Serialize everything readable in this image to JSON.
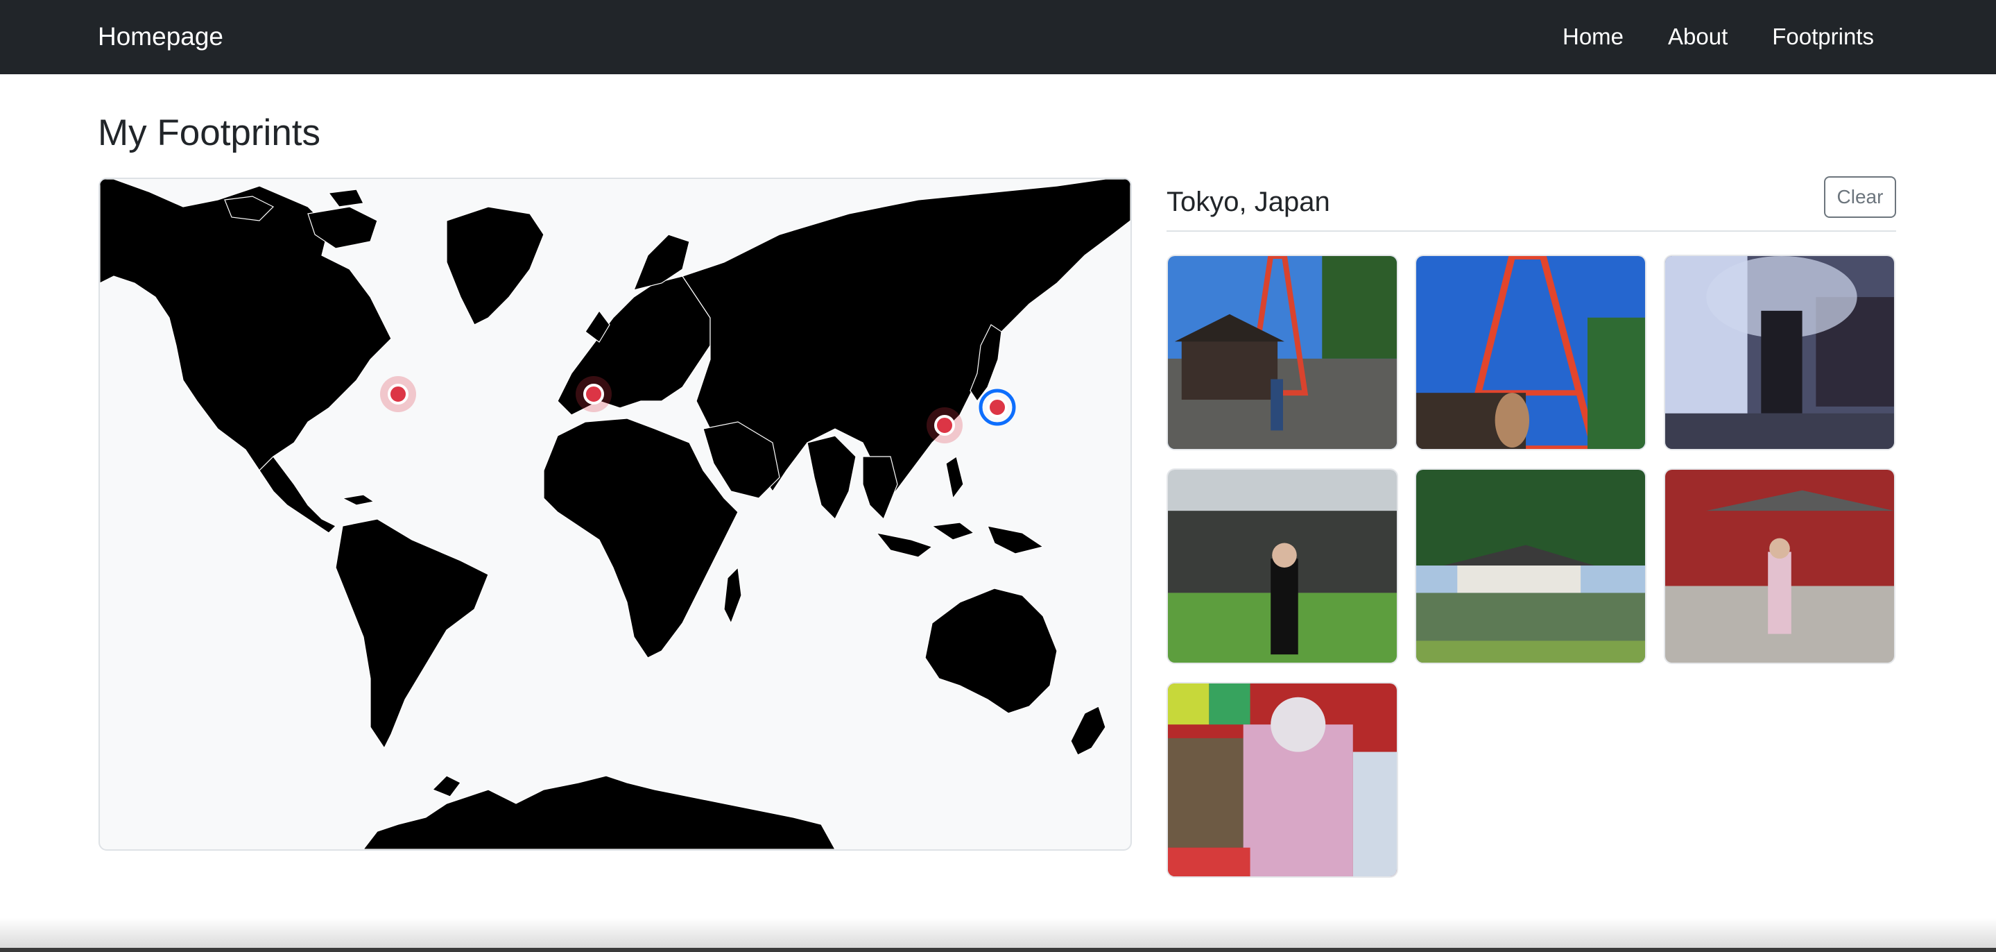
{
  "navbar": {
    "brand": "Homepage",
    "links": [
      "Home",
      "About",
      "Footprints"
    ]
  },
  "page": {
    "title": "My Footprints"
  },
  "map": {
    "markers": [
      {
        "name": "eastern-north-america",
        "selected": false
      },
      {
        "name": "western-europe",
        "selected": false
      },
      {
        "name": "eastern-china",
        "selected": false
      },
      {
        "name": "japan",
        "selected": true
      }
    ],
    "marker_color": "#dc3545",
    "selected_ring_color": "#0d6efd"
  },
  "panel": {
    "location": "Tokyo, Japan",
    "clear_label": "Clear",
    "photos": [
      {
        "subject": "tower-and-temple"
      },
      {
        "subject": "red-tower-closeup"
      },
      {
        "subject": "person-with-umbrella"
      },
      {
        "subject": "person-on-lawn"
      },
      {
        "subject": "garden-pavilion-pond"
      },
      {
        "subject": "person-at-red-temple"
      },
      {
        "subject": "person-in-kimono"
      }
    ]
  },
  "colors": {
    "navbar_bg": "#212529",
    "accent": "#dc3545"
  }
}
